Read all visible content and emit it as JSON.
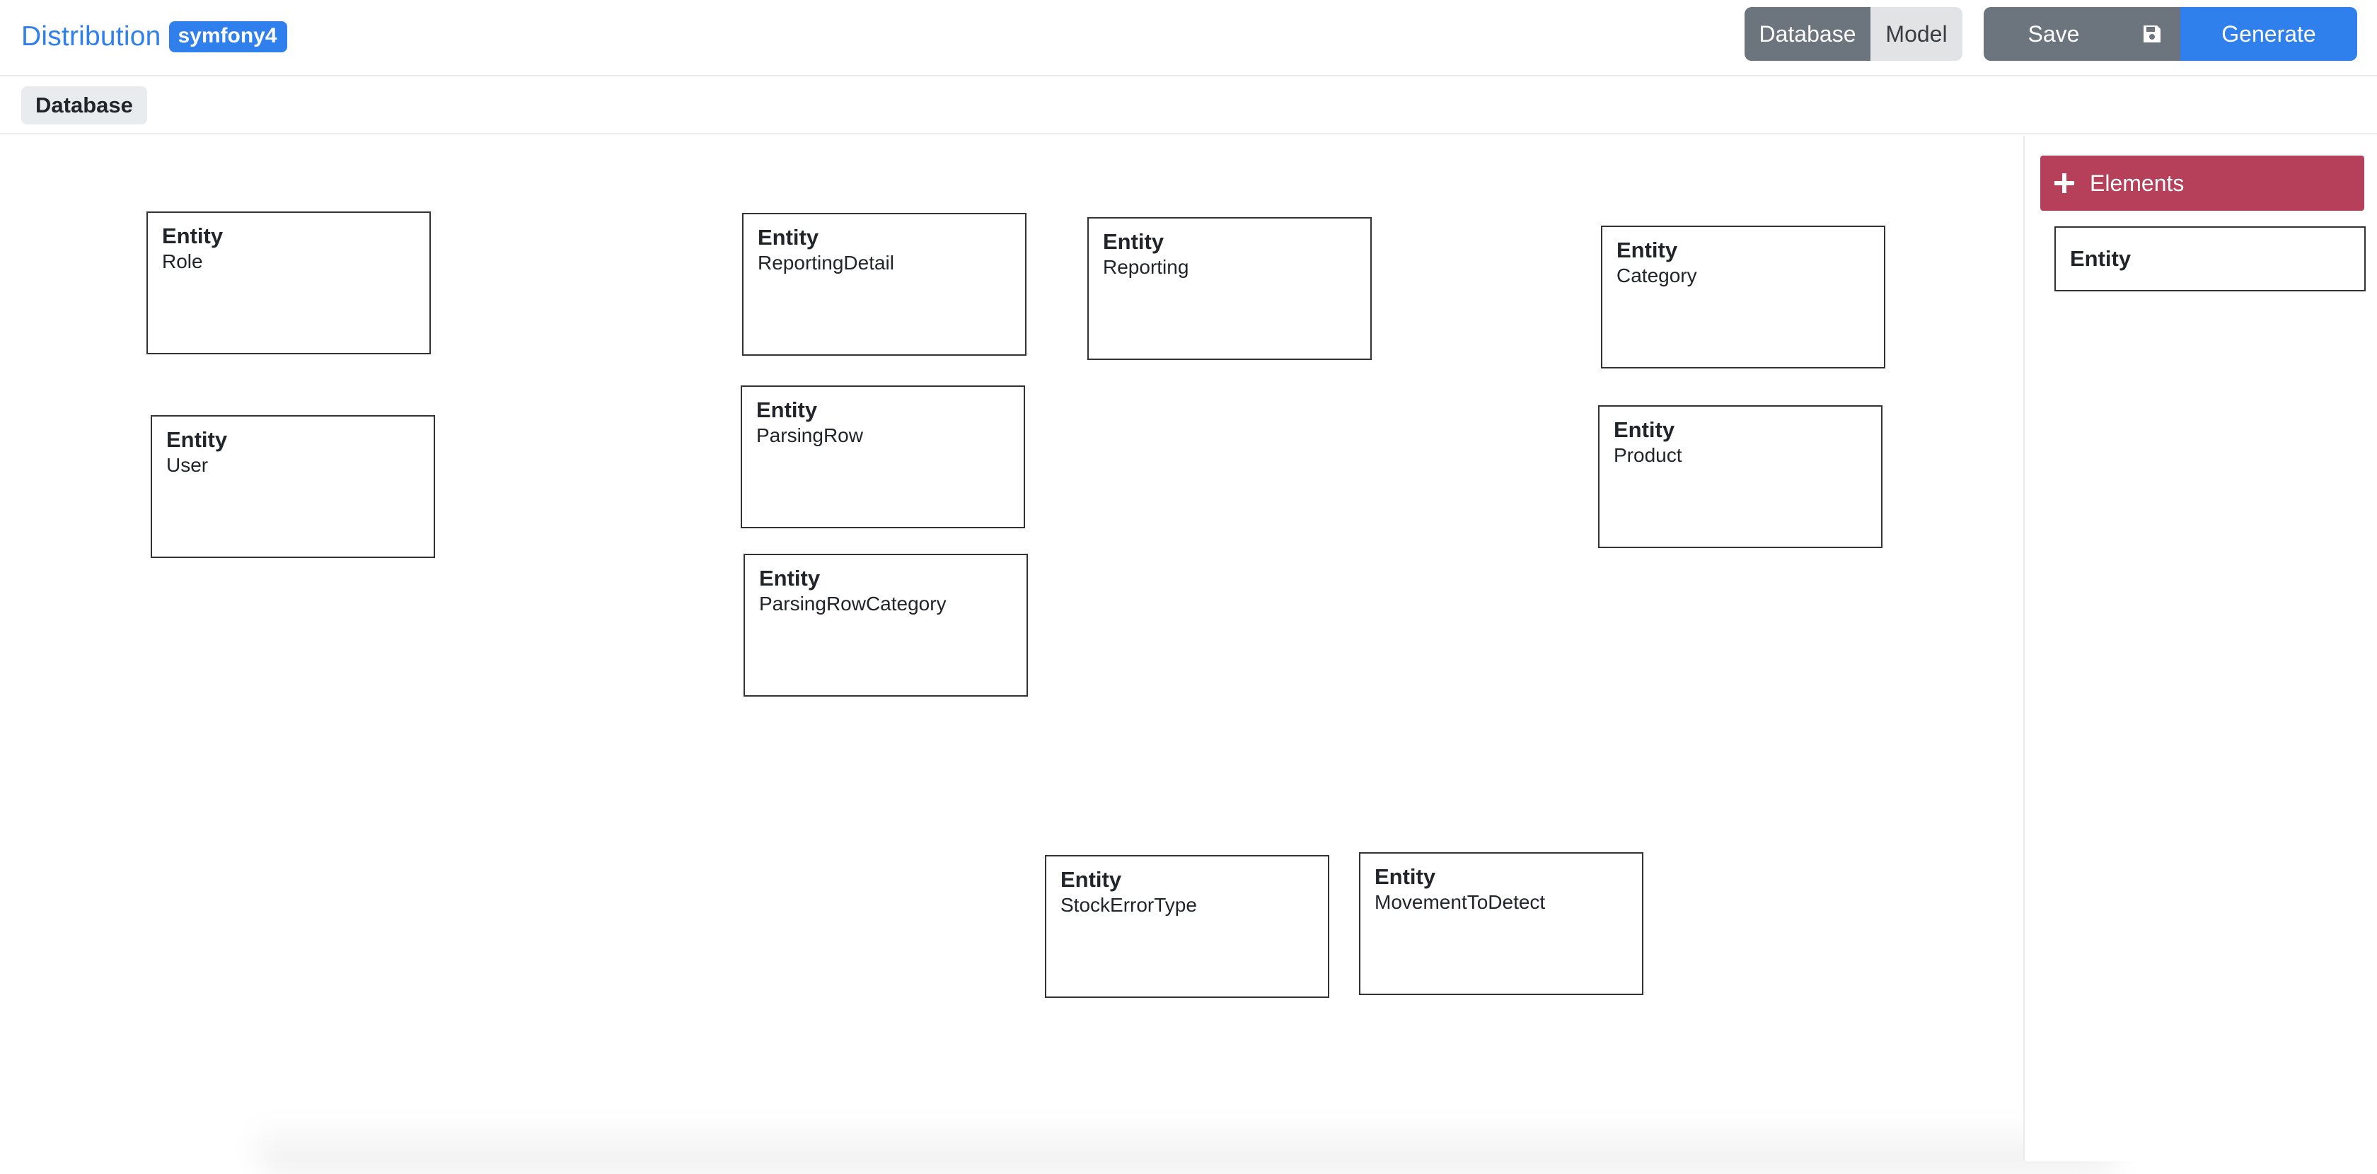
{
  "header": {
    "brand_title": "Distribution",
    "brand_badge": "symfony4",
    "view_toggle": {
      "database_label": "Database",
      "model_label": "Model",
      "active": "Database"
    },
    "actions": {
      "save_label": "Save",
      "save_icon": "floppy-disk-icon",
      "generate_label": "Generate"
    }
  },
  "subbar": {
    "tag_label": "Database"
  },
  "entities": [
    {
      "type": "Entity",
      "name": "Role"
    },
    {
      "type": "Entity",
      "name": "ReportingDetail"
    },
    {
      "type": "Entity",
      "name": "Reporting"
    },
    {
      "type": "Entity",
      "name": "Category"
    },
    {
      "type": "Entity",
      "name": "User"
    },
    {
      "type": "Entity",
      "name": "ParsingRow"
    },
    {
      "type": "Entity",
      "name": "Product"
    },
    {
      "type": "Entity",
      "name": "ParsingRowCategory"
    },
    {
      "type": "Entity",
      "name": "StockErrorType"
    },
    {
      "type": "Entity",
      "name": "MovementToDetect"
    }
  ],
  "side_panel": {
    "header_label": "Elements",
    "header_icon": "plus-icon",
    "palette_items": [
      {
        "label": "Entity"
      }
    ]
  },
  "colors": {
    "brand_blue": "#2f80ed",
    "secondary_gray": "#6c757d",
    "elements_red": "#b6405a"
  }
}
